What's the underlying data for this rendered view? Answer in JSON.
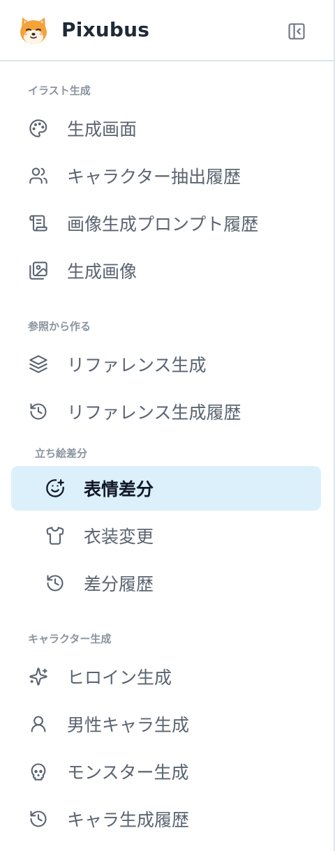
{
  "app": {
    "name": "Pixubus"
  },
  "header": {
    "collapse_icon": "panel-left-close-icon"
  },
  "sections": {
    "illust": {
      "label": "イラスト生成",
      "items": [
        {
          "label": "生成画面",
          "icon": "palette-icon"
        },
        {
          "label": "キャラクター抽出履歴",
          "icon": "users-icon"
        },
        {
          "label": "画像生成プロンプト履歴",
          "icon": "scroll-text-icon"
        },
        {
          "label": "生成画像",
          "icon": "images-icon"
        }
      ]
    },
    "reference": {
      "label": "参照から作る",
      "items": [
        {
          "label": "リファレンス生成",
          "icon": "layers-icon"
        },
        {
          "label": "リファレンス生成履歴",
          "icon": "history-icon"
        }
      ]
    },
    "standing": {
      "label": "立ち絵差分",
      "items": [
        {
          "label": "表情差分",
          "icon": "smile-plus-icon",
          "active": true
        },
        {
          "label": "衣装変更",
          "icon": "shirt-icon"
        },
        {
          "label": "差分履歴",
          "icon": "history-icon"
        }
      ]
    },
    "character": {
      "label": "キャラクター生成",
      "items": [
        {
          "label": "ヒロイン生成",
          "icon": "sparkles-icon"
        },
        {
          "label": "男性キャラ生成",
          "icon": "user-icon"
        },
        {
          "label": "モンスター生成",
          "icon": "skull-icon"
        },
        {
          "label": "キャラ生成履歴",
          "icon": "history-icon"
        }
      ]
    }
  },
  "colors": {
    "active_bg": "#dcf0fb",
    "text": "#5a6371",
    "active_text": "#111827",
    "section_label": "#8a939f"
  }
}
